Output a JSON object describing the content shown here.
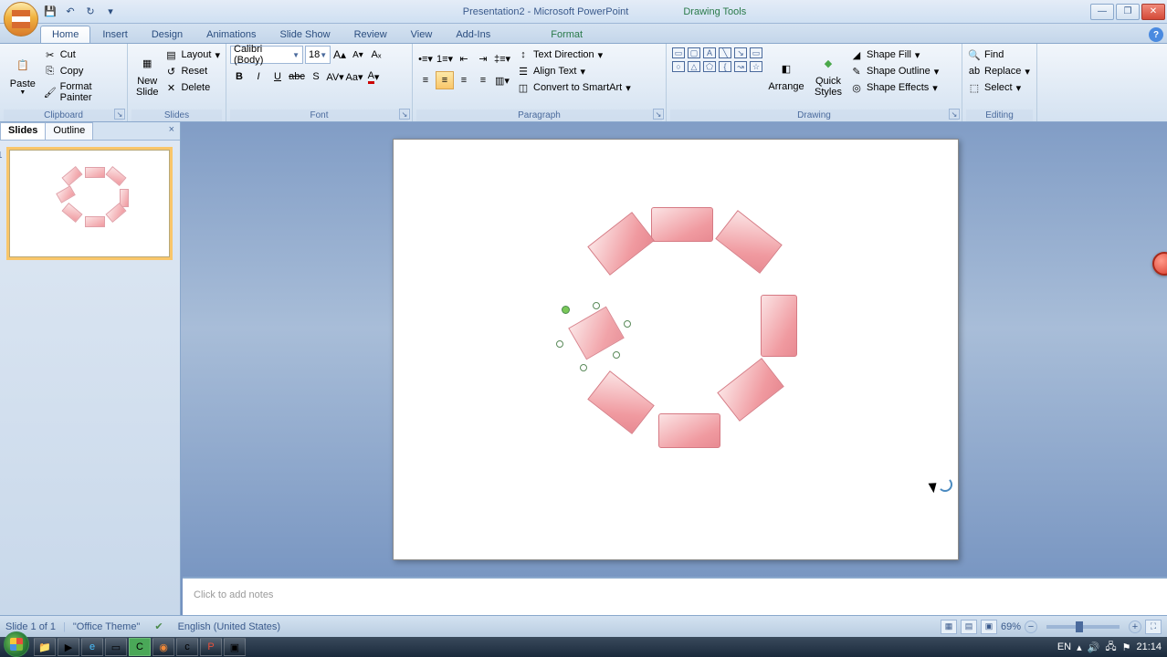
{
  "title": "Presentation2 - Microsoft PowerPoint",
  "tools_title": "Drawing Tools",
  "qat": {
    "save": "💾",
    "undo": "↶",
    "redo": "↻"
  },
  "tabs": [
    "Home",
    "Insert",
    "Design",
    "Animations",
    "Slide Show",
    "Review",
    "View",
    "Add-Ins"
  ],
  "format_tab": "Format",
  "clipboard": {
    "paste": "Paste",
    "cut": "Cut",
    "copy": "Copy",
    "painter": "Format Painter",
    "label": "Clipboard"
  },
  "slides_grp": {
    "new": "New\nSlide",
    "layout": "Layout",
    "reset": "Reset",
    "delete": "Delete",
    "label": "Slides"
  },
  "font": {
    "name": "Calibri (Body)",
    "size": "18",
    "label": "Font"
  },
  "paragraph": {
    "textdir": "Text Direction",
    "align": "Align Text",
    "convert": "Convert to SmartArt",
    "label": "Paragraph"
  },
  "drawing": {
    "arrange": "Arrange",
    "quick": "Quick\nStyles",
    "fill": "Shape Fill",
    "outline": "Shape Outline",
    "effects": "Shape Effects",
    "label": "Drawing"
  },
  "editing": {
    "find": "Find",
    "replace": "Replace",
    "select": "Select",
    "label": "Editing"
  },
  "pane": {
    "slides_tab": "Slides",
    "outline_tab": "Outline",
    "close": "×",
    "thumb1": "1"
  },
  "notes_placeholder": "Click to add notes",
  "status": {
    "slide": "Slide 1 of 1",
    "theme": "\"Office Theme\"",
    "lang": "English (United States)",
    "zoom": "69%"
  },
  "tray": {
    "lang": "EN",
    "time": "21:14"
  },
  "win": {
    "min": "—",
    "max": "❐",
    "close": "✕"
  }
}
